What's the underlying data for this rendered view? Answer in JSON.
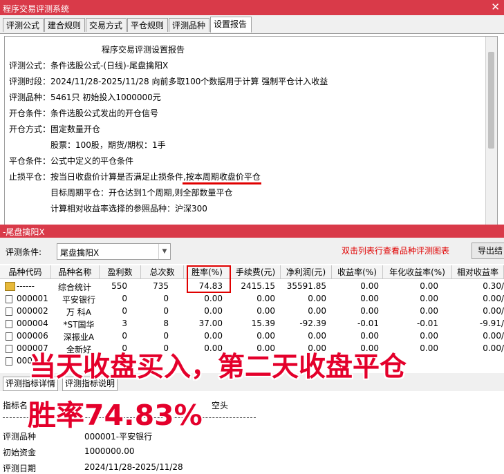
{
  "window": {
    "title": "程序交易评测系统",
    "close_glyph": "✕"
  },
  "tabs": [
    "评测公式",
    "建合规则",
    "交易方式",
    "平仓规则",
    "评测品种",
    "设置报告"
  ],
  "active_tab": "设置报告",
  "report": {
    "title": "程序交易评测设置报告",
    "lines": [
      "评测公式：条件选股公式-(日线)-尾盘擒阳X",
      "评测时段：2024/11/28-2025/11/28 向前多取100个数据用于计算 强制平仓计入收益",
      "评测品种：5461只 初始投入1000000元",
      "开仓条件：条件选股公式发出的开仓信号",
      "开仓方式：固定数量开仓",
      "股票：100股，期货/期权：1手",
      "平仓条件：公式中定义的平仓条件",
      "止损平仓：按当日收盘价计算是否满足止损条件,按本周期收盘价平仓",
      "目标周期平仓：开仓达到1个周期,则全部数量平仓",
      "计算相对收益率选择的参照品种：沪深300"
    ]
  },
  "panel": {
    "title": "-尾盘擒阳X",
    "condition_label": "评测条件:",
    "condition_value": "尾盘擒阳X",
    "hint": "双击列表行查看品种评测图表",
    "export_label": "导出结"
  },
  "table": {
    "columns": [
      "品种代码",
      "品种名称",
      "盈利数",
      "总次数",
      "胜率(%)",
      "手续费(元)",
      "净利润(元)",
      "收益率(%)",
      "年化收益率(%)",
      "相对收益率"
    ],
    "rows": [
      [
        "------",
        "综合统计",
        "550",
        "735",
        "74.83",
        "2415.15",
        "35591.85",
        "0.00",
        "0.00",
        "0.30/"
      ],
      [
        "000001",
        "平安银行",
        "0",
        "0",
        "0.00",
        "0.00",
        "0.00",
        "0.00",
        "0.00",
        "0.00/"
      ],
      [
        "000002",
        "万 科A",
        "0",
        "0",
        "0.00",
        "0.00",
        "0.00",
        "0.00",
        "0.00",
        "0.00/"
      ],
      [
        "000004",
        "*ST国华",
        "3",
        "8",
        "37.00",
        "15.39",
        "-92.39",
        "-0.01",
        "-0.01",
        "-9.91/"
      ],
      [
        "000006",
        "深振业A",
        "0",
        "0",
        "0.00",
        "0.00",
        "0.00",
        "0.00",
        "0.00",
        "0.00/"
      ],
      [
        "000007",
        "全新好",
        "0",
        "0",
        "0.00",
        "0.00",
        "0.00",
        "0.00",
        "0.00",
        "0.00/"
      ],
      [
        "000",
        "",
        "",
        "",
        "",
        "",
        "",
        "",
        "",
        ""
      ]
    ]
  },
  "lower_tabs": [
    "评测指标详情",
    "评测指标说明"
  ],
  "lower": {
    "header_name": "指标名",
    "header_side": "空头",
    "fields": [
      {
        "label": "评测品种",
        "value": "000001-平安银行"
      },
      {
        "label": "初始资金",
        "value": "1000000.00"
      },
      {
        "label": "评测日期",
        "value": "2024/11/28-2025/11/28"
      }
    ]
  },
  "overlay": {
    "line1": "当天收盘买入，第二天收盘平仓",
    "line2": "胜率74.83%"
  },
  "colors": {
    "title_bar": "#d93a49",
    "highlight_red": "#e00000",
    "overlay_red": "#e4002b"
  }
}
